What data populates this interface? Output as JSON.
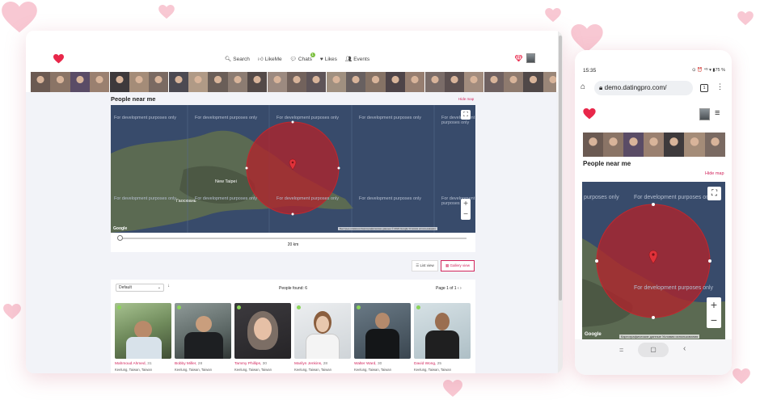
{
  "colors": {
    "accent": "#d2245c",
    "online": "#8bd45a",
    "map_circle": "#c0292f",
    "map_water": "#384b6b"
  },
  "desktop": {
    "nav": {
      "search": "Search",
      "likeme": "LikeMe",
      "chats": "Chats",
      "chats_badge": "1",
      "likes": "Likes",
      "events": "Events"
    },
    "people_near_me": "People near me",
    "hide_map": "Hide map",
    "map": {
      "watermark": "For development purposes only",
      "city1": "New Taipei",
      "city2": "Гаосюань",
      "fullscreen_icon": "⛶",
      "zoom_in": "+",
      "zoom_out": "−",
      "attribution": "Быстрые клавиши    Картографические данные © 2024 Google    Условия использования",
      "google": "Google"
    },
    "distance": "20 km",
    "list_view": "List view",
    "gallery_view": "Gallery view",
    "sort": "Default",
    "people_found": "People found: 6",
    "page": "Page 1 of 1  ‹  ›",
    "cards": [
      {
        "name": "Mahmoud Ahmed,",
        "age": " 31",
        "loc": "Keelung, Taiwan, Taiwan"
      },
      {
        "name": "Bobby Miller,",
        "age": " 28",
        "loc": "Keelung, Taiwan, Taiwan"
      },
      {
        "name": "Tammy Phillips,",
        "age": " 30",
        "loc": "Keelung, Taiwan, Taiwan"
      },
      {
        "name": "Marilyn Jenkins,",
        "age": " 28",
        "loc": "Keelung, Taiwan, Taiwan"
      },
      {
        "name": "Walter Ward,",
        "age": " 30",
        "loc": "Keelung, Taiwan, Taiwan"
      },
      {
        "name": "David Wong,",
        "age": " 25",
        "loc": "Keelung, Taiwan, Taiwan"
      }
    ]
  },
  "mobile": {
    "time": "15:35",
    "status_icons": "⊙ ⏰ ⁴ᴳ ▾ ▮75 %",
    "url": "demo.datingpro.com/",
    "tabs": "1",
    "people_near_me": "People near me",
    "hide_map": "Hide map",
    "map": {
      "watermark": "For development purposes only",
      "watermark_left": "purposes only",
      "attribution": "Картографические данные  Условия использования",
      "google": "Google"
    },
    "nav": {
      "menu": "=",
      "home": "▢",
      "back": "‹"
    }
  }
}
